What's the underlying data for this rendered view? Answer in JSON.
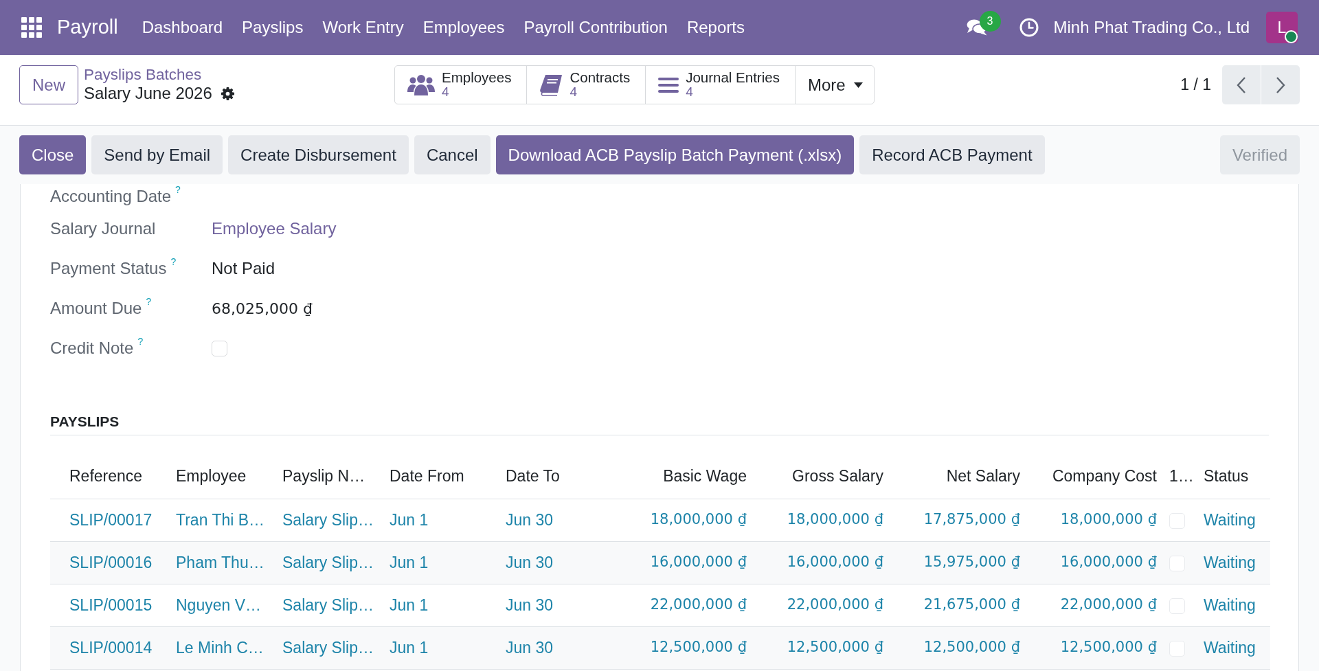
{
  "navbar": {
    "app_name": "Payroll",
    "menu": [
      "Dashboard",
      "Payslips",
      "Work Entry",
      "Employees",
      "Payroll Contribution",
      "Reports"
    ],
    "message_count": "3",
    "company": "Minh Phat Trading Co., Ltd",
    "avatar": {
      "initial": "L",
      "online": true
    }
  },
  "control_panel": {
    "new_button": "New",
    "breadcrumb": "Payslips Batches",
    "record_title": "Salary June 2026",
    "smart_buttons": [
      {
        "label": "Employees",
        "count": "4"
      },
      {
        "label": "Contracts",
        "count": "4"
      },
      {
        "label": "Journal Entries",
        "count": "4"
      }
    ],
    "more_button": "More",
    "pager": "1 / 1"
  },
  "action_bar": {
    "buttons": [
      {
        "label": "Close",
        "kind": "primary"
      },
      {
        "label": "Send by Email",
        "kind": "secondary"
      },
      {
        "label": "Create Disbursement",
        "kind": "secondary"
      },
      {
        "label": "Cancel",
        "kind": "secondary"
      },
      {
        "label": "Download ACB Payslip Batch Payment (.xlsx)",
        "kind": "primary"
      },
      {
        "label": "Record ACB Payment",
        "kind": "secondary"
      }
    ],
    "status": {
      "label": "Verified",
      "disabled": true
    }
  },
  "form": {
    "fields": [
      {
        "label": "Accounting Date",
        "help": "?",
        "kind": "text"
      },
      {
        "label": "Salary Journal",
        "kind": "link",
        "value": "Employee Salary"
      },
      {
        "label": "Payment Status",
        "help": "?",
        "kind": "text",
        "value": "Not Paid"
      },
      {
        "label": "Amount Due",
        "help": "?",
        "kind": "money",
        "value": "68,025,000 ₫"
      },
      {
        "label": "Credit Note",
        "help": "?",
        "kind": "checkbox",
        "checked": false
      }
    ]
  },
  "payslips": {
    "title": "PAYSLIPS",
    "columns": [
      {
        "label": "Reference",
        "kind": "text"
      },
      {
        "label": "Employee",
        "kind": "text"
      },
      {
        "label": "Payslip N…",
        "kind": "text"
      },
      {
        "label": "Date From",
        "kind": "text"
      },
      {
        "label": "Date To",
        "kind": "text"
      },
      {
        "label": "Basic Wage",
        "kind": "money"
      },
      {
        "label": "Gross Salary",
        "kind": "money"
      },
      {
        "label": "Net Salary",
        "kind": "money"
      },
      {
        "label": "Company Cost",
        "kind": "money"
      },
      {
        "label": "1…",
        "kind": "checkbox"
      },
      {
        "label": "Status",
        "kind": "text"
      }
    ],
    "rows": [
      {
        "cells": [
          "SLIP/00017",
          "Tran Thi B…",
          "Salary Slip…",
          "Jun 1",
          "Jun 30",
          "18,000,000 ₫",
          "18,000,000 ₫",
          "17,875,000 ₫",
          "18,000,000 ₫",
          {
            "checked": false
          },
          "Waiting"
        ]
      },
      {
        "cells": [
          "SLIP/00016",
          "Pham Thu…",
          "Salary Slip…",
          "Jun 1",
          "Jun 30",
          "16,000,000 ₫",
          "16,000,000 ₫",
          "15,975,000 ₫",
          "16,000,000 ₫",
          {
            "checked": false
          },
          "Waiting"
        ]
      },
      {
        "cells": [
          "SLIP/00015",
          "Nguyen V…",
          "Salary Slip…",
          "Jun 1",
          "Jun 30",
          "22,000,000 ₫",
          "22,000,000 ₫",
          "21,675,000 ₫",
          "22,000,000 ₫",
          {
            "checked": false
          },
          "Waiting"
        ]
      },
      {
        "cells": [
          "SLIP/00014",
          "Le Minh C…",
          "Salary Slip…",
          "Jun 1",
          "Jun 30",
          "12,500,000 ₫",
          "12,500,000 ₫",
          "12,500,000 ₫",
          "12,500,000 ₫",
          {
            "checked": false
          },
          "Waiting"
        ]
      }
    ]
  }
}
